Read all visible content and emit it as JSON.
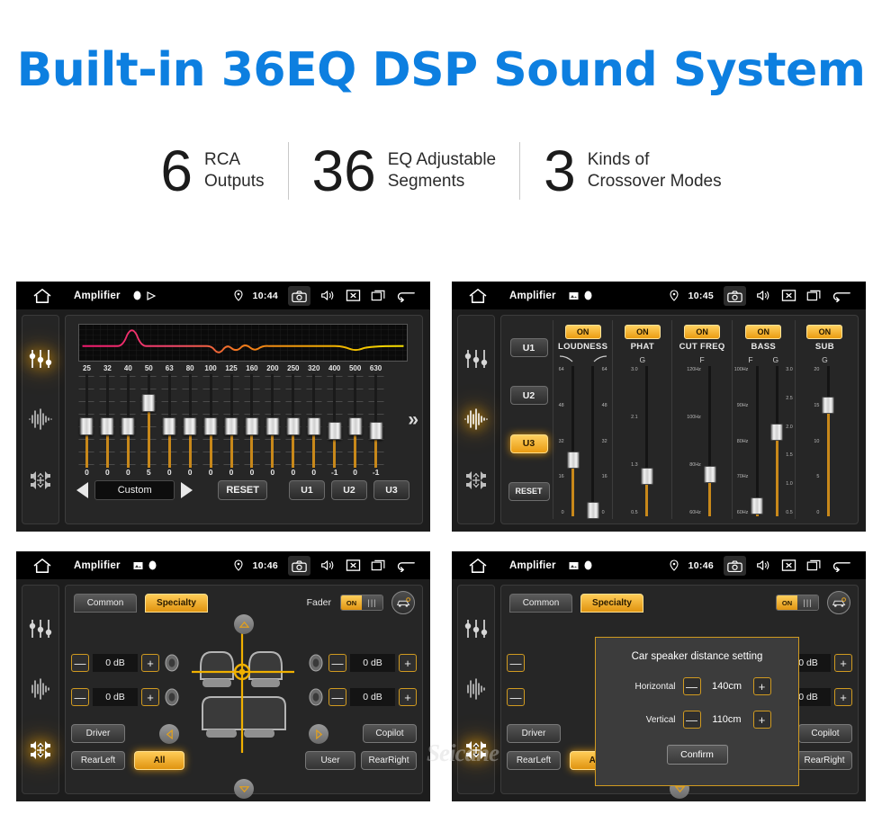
{
  "header": {
    "title": "Built-in 36EQ DSP Sound System",
    "title_color": "#0d7fe0",
    "stats": [
      {
        "number": "6",
        "line1": "RCA",
        "line2": "Outputs"
      },
      {
        "number": "36",
        "line1": "EQ Adjustable",
        "line2": "Segments"
      },
      {
        "number": "3",
        "line1": "Kinds of",
        "line2": "Crossover Modes"
      }
    ]
  },
  "watermark": "Seicane",
  "accent": {
    "orange": "#e09410",
    "track": "#c8881a",
    "blue": "#0d7fe0"
  },
  "panel_eq": {
    "statusbar": {
      "title": "Amplifier",
      "time": "10:44",
      "home_icon": "home-icon",
      "mini_icons": [
        "circle-icon",
        "play-small-icon"
      ],
      "right_icons": [
        "location-pin-icon",
        "camera-icon",
        "volume-icon",
        "close-box-icon",
        "recents-icon",
        "back-arrow-icon"
      ]
    },
    "sidebar": [
      {
        "icon": "equalizer-icon",
        "active": true
      },
      {
        "icon": "waveform-icon",
        "active": false
      },
      {
        "icon": "balance-icon",
        "active": false
      }
    ],
    "bands": [
      "25",
      "32",
      "40",
      "50",
      "63",
      "80",
      "100",
      "125",
      "160",
      "200",
      "250",
      "320",
      "400",
      "500",
      "630"
    ],
    "values": [
      "0",
      "0",
      "0",
      "5",
      "0",
      "0",
      "0",
      "0",
      "0",
      "0",
      "0",
      "0",
      "-1",
      "0",
      "-1"
    ],
    "next_icon": "»",
    "preset_prev_icon": "arrow-left-icon",
    "preset_label": "Custom",
    "preset_next_icon": "arrow-right-icon",
    "reset_label": "RESET",
    "user_presets": [
      "U1",
      "U2",
      "U3"
    ]
  },
  "panel_xover": {
    "statusbar": {
      "title": "Amplifier",
      "time": "10:45",
      "mini_icons": [
        "image-icon",
        "circle-icon"
      ]
    },
    "sidebar_active_index": 1,
    "presets": [
      "U1",
      "U2",
      "U3"
    ],
    "preset_active": "U3",
    "reset_label": "RESET",
    "sections": [
      {
        "name": "LOUDNESS",
        "state": "ON",
        "subs": [
          "curve-down-icon",
          "curve-up-icon"
        ],
        "faders": [
          {
            "scale": [
              "64",
              "48",
              "32",
              "16",
              "0"
            ],
            "knob_pct": 62,
            "side": "left"
          },
          {
            "scale": [
              "64",
              "48",
              "32",
              "16",
              "0"
            ],
            "knob_pct": 96,
            "side": "right"
          }
        ]
      },
      {
        "name": "PHAT",
        "state": "ON",
        "subs": [
          "G"
        ],
        "faders": [
          {
            "scale": [
              "3.0",
              "2.1",
              "1.3",
              "0.5"
            ],
            "knob_pct": 73,
            "side": "left"
          }
        ]
      },
      {
        "name": "CUT FREQ",
        "state": "ON",
        "subs": [
          "F"
        ],
        "faders": [
          {
            "scale": [
              "120Hz",
              "100Hz",
              "80Hz",
              "60Hz"
            ],
            "knob_pct": 72,
            "side": "left"
          }
        ]
      },
      {
        "name": "BASS",
        "state": "ON",
        "subs": [
          "F",
          "G"
        ],
        "faders": [
          {
            "scale": [
              "100Hz",
              "90Hz",
              "80Hz",
              "70Hz",
              "60Hz"
            ],
            "knob_pct": 93,
            "side": "left"
          },
          {
            "scale": [
              "3.0",
              "2.5",
              "2.0",
              "1.5",
              "1.0",
              "0.5"
            ],
            "knob_pct": 44,
            "side": "right"
          }
        ]
      },
      {
        "name": "SUB",
        "state": "ON",
        "subs": [
          "G"
        ],
        "faders": [
          {
            "scale": [
              "20",
              "15",
              "10",
              "5",
              "0"
            ],
            "knob_pct": 26,
            "side": "left"
          }
        ]
      }
    ]
  },
  "panel_balance": {
    "statusbar": {
      "title": "Amplifier",
      "time": "10:46",
      "mini_icons": [
        "image-icon",
        "circle-icon"
      ]
    },
    "sidebar_active_index": 2,
    "tabs": [
      {
        "label": "Common",
        "active": false
      },
      {
        "label": "Specialty",
        "active": true
      }
    ],
    "fader_label": "Fader",
    "fader_toggle": "ON",
    "car_setup_icon": "car-speaker-icon",
    "levels": {
      "front_left": "0 dB",
      "rear_left": "0 dB",
      "front_right": "0 dB",
      "rear_right": "0 dB"
    },
    "minus_icon": "—",
    "plus_icon": "+",
    "seat_buttons": [
      {
        "label": "Driver",
        "active": false
      },
      {
        "label": "RearLeft",
        "active": false
      },
      {
        "label": "All",
        "active": true
      },
      {
        "label": "User",
        "active": false
      },
      {
        "label": "Copilot",
        "active": false
      },
      {
        "label": "RearRight",
        "active": false
      }
    ],
    "nav_icons": [
      "nav-up-icon",
      "nav-down-icon",
      "nav-left-icon",
      "nav-right-icon"
    ]
  },
  "panel_dialog": {
    "statusbar": {
      "title": "Amplifier",
      "time": "10:46",
      "mini_icons": [
        "image-icon",
        "circle-icon"
      ]
    },
    "sidebar_active_index": 2,
    "dialog": {
      "title": "Car speaker distance setting",
      "rows": [
        {
          "label": "Horizontal",
          "value": "140cm"
        },
        {
          "label": "Vertical",
          "value": "110cm"
        }
      ],
      "minus_icon": "—",
      "plus_icon": "+",
      "confirm_label": "Confirm"
    }
  }
}
